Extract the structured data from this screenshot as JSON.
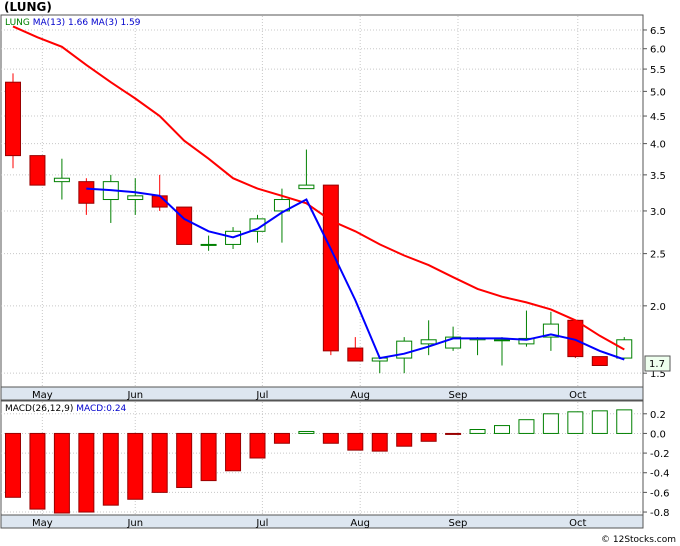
{
  "title": "(LUNG)",
  "watermark": "© 12Stocks.com",
  "price_panel": {
    "legend": [
      {
        "text": "LUNG",
        "color": "#008000"
      },
      {
        "text": "MA(13)",
        "color": "#0000cc"
      },
      {
        "text": "1.66",
        "color": "#0000cc"
      },
      {
        "text": "MA(3)",
        "color": "#0000cc"
      },
      {
        "text": "1.59",
        "color": "#0000cc"
      }
    ],
    "last_price_label": "1.7",
    "y_ticks": [
      "6.5",
      "6.0",
      "5.5",
      "5.0",
      "4.5",
      "4.0",
      "3.5",
      "3.0",
      "2.5",
      "2.0",
      "1.5"
    ],
    "x_labels": [
      "May",
      "Jun",
      "Jul",
      "Aug",
      "Sep",
      "Oct"
    ]
  },
  "macd_panel": {
    "legend": [
      {
        "text": "MACD(26,12,9)",
        "color": "#000000"
      },
      {
        "text": "MACD:0.24",
        "color": "#0000cc"
      }
    ],
    "y_ticks": [
      "0.2",
      "0.0",
      "-0.2",
      "-0.4",
      "-0.6",
      "-0.8"
    ],
    "x_labels": [
      "May",
      "Jun",
      "Jul",
      "Aug",
      "Sep",
      "Oct"
    ]
  },
  "colors": {
    "up": "#008000",
    "down": "#ff0000",
    "ma13": "#ff0000",
    "ma3": "#0000ff",
    "label_box": "#eeffee",
    "axis_strip": "#dde6f0"
  },
  "chart_data": [
    {
      "type": "candlestick",
      "scale": "log",
      "ylim": [
        1.42,
        6.9
      ],
      "candles": [
        {
          "o": 5.2,
          "h": 5.4,
          "l": 3.6,
          "c": 3.8
        },
        {
          "o": 3.8,
          "h": 3.8,
          "l": 3.35,
          "c": 3.35
        },
        {
          "o": 3.4,
          "h": 3.75,
          "l": 3.15,
          "c": 3.45
        },
        {
          "o": 3.4,
          "h": 3.45,
          "l": 2.95,
          "c": 3.1
        },
        {
          "o": 3.15,
          "h": 3.5,
          "l": 2.85,
          "c": 3.4
        },
        {
          "o": 3.15,
          "h": 3.45,
          "l": 2.95,
          "c": 3.2
        },
        {
          "o": 3.2,
          "h": 3.5,
          "l": 3.0,
          "c": 3.05
        },
        {
          "o": 3.05,
          "h": 3.05,
          "l": 2.6,
          "c": 2.6
        },
        {
          "o": 2.6,
          "h": 2.7,
          "l": 2.53,
          "c": 2.6
        },
        {
          "o": 2.6,
          "h": 2.8,
          "l": 2.55,
          "c": 2.75
        },
        {
          "o": 2.75,
          "h": 2.95,
          "l": 2.62,
          "c": 2.9
        },
        {
          "o": 3.0,
          "h": 3.3,
          "l": 2.62,
          "c": 3.15
        },
        {
          "o": 3.3,
          "h": 3.9,
          "l": 3.3,
          "c": 3.35
        },
        {
          "o": 3.35,
          "h": 3.35,
          "l": 1.62,
          "c": 1.65
        },
        {
          "o": 1.67,
          "h": 1.75,
          "l": 1.58,
          "c": 1.58
        },
        {
          "o": 1.58,
          "h": 1.6,
          "l": 1.5,
          "c": 1.6
        },
        {
          "o": 1.6,
          "h": 1.75,
          "l": 1.5,
          "c": 1.72
        },
        {
          "o": 1.7,
          "h": 1.88,
          "l": 1.62,
          "c": 1.73
        },
        {
          "o": 1.67,
          "h": 1.83,
          "l": 1.65,
          "c": 1.75
        },
        {
          "o": 1.73,
          "h": 1.75,
          "l": 1.62,
          "c": 1.74
        },
        {
          "o": 1.73,
          "h": 1.75,
          "l": 1.55,
          "c": 1.73
        },
        {
          "o": 1.7,
          "h": 1.96,
          "l": 1.68,
          "c": 1.74
        },
        {
          "o": 1.75,
          "h": 1.95,
          "l": 1.65,
          "c": 1.85
        },
        {
          "o": 1.88,
          "h": 1.88,
          "l": 1.6,
          "c": 1.61
        },
        {
          "o": 1.61,
          "h": 1.61,
          "l": 1.55,
          "c": 1.55
        },
        {
          "o": 1.6,
          "h": 1.75,
          "l": 1.6,
          "c": 1.73
        }
      ],
      "ma13": [
        6.6,
        6.3,
        6.05,
        5.6,
        5.2,
        4.85,
        4.5,
        4.05,
        3.75,
        3.45,
        3.3,
        3.2,
        3.1,
        2.88,
        2.75,
        2.6,
        2.48,
        2.38,
        2.26,
        2.15,
        2.08,
        2.03,
        1.97,
        1.88,
        1.76,
        1.66
      ],
      "ma3": [
        null,
        null,
        null,
        3.3,
        3.28,
        3.25,
        3.2,
        2.9,
        2.75,
        2.68,
        2.78,
        2.98,
        3.15,
        2.55,
        2.05,
        1.6,
        1.63,
        1.68,
        1.74,
        1.74,
        1.74,
        1.73,
        1.77,
        1.73,
        1.65,
        1.59
      ]
    },
    {
      "type": "bar",
      "title": "MACD(26,12,9)",
      "ylim": [
        -0.82,
        0.32
      ],
      "values": [
        -0.65,
        -0.77,
        -0.81,
        -0.8,
        -0.73,
        -0.67,
        -0.6,
        -0.55,
        -0.48,
        -0.38,
        -0.25,
        -0.1,
        0.02,
        -0.1,
        -0.17,
        -0.18,
        -0.13,
        -0.08,
        -0.01,
        0.04,
        0.08,
        0.14,
        0.2,
        0.22,
        0.23,
        0.24
      ]
    }
  ]
}
